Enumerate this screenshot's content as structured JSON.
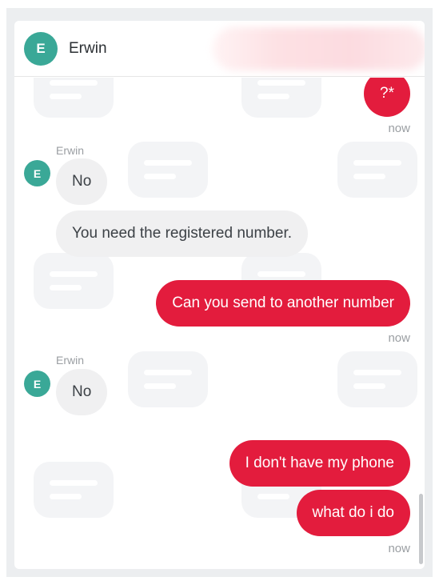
{
  "header": {
    "avatar_initial": "E",
    "contact_name": "Erwin"
  },
  "messages": [
    {
      "type": "sent",
      "text": "?*",
      "time": "now"
    },
    {
      "type": "received",
      "sender": "Erwin",
      "avatar_initial": "E",
      "texts": [
        "No",
        "You need the registered number."
      ]
    },
    {
      "type": "sent",
      "text": "Can you send to another number",
      "time": "now"
    },
    {
      "type": "received",
      "sender": "Erwin",
      "avatar_initial": "E",
      "texts": [
        "No"
      ]
    },
    {
      "type": "sent",
      "texts": [
        "I don't have my phone",
        "what do i do"
      ],
      "time": "now"
    }
  ],
  "colors": {
    "brand_red": "#e8203e",
    "sent_bubble": "#e31c3d",
    "received_bubble": "#f0f0f1",
    "avatar": "#3aa897"
  }
}
